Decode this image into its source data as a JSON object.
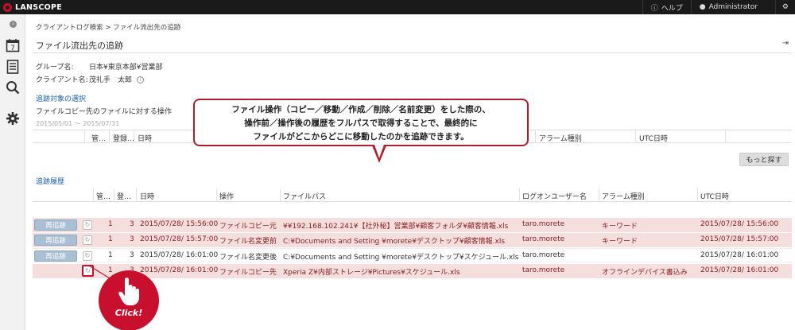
{
  "topbar": {
    "brand": "LANSCOPE",
    "help": "ヘルプ",
    "user": "Administrator",
    "help_icon": "question-circle-icon",
    "user_icon": "user-icon",
    "settings_icon": "gear-icon"
  },
  "sidebar": {
    "items": [
      {
        "name": "calendar",
        "icon": "calendar-icon",
        "glyph": "7"
      },
      {
        "name": "log",
        "icon": "document-icon"
      },
      {
        "name": "search",
        "icon": "search-icon"
      },
      {
        "name": "settings",
        "icon": "gear-icon"
      }
    ]
  },
  "breadcrumb": "クライアントログ検索 > ファイル流出先の追跡",
  "page_title": "ファイル流出先の追跡",
  "info": {
    "group_label": "グループ名:",
    "group_value": "日本¥東京本部¥営業部",
    "client_label": "クライアント名:",
    "client_value": "茂礼手　太郎"
  },
  "selection": {
    "title": "追跡対象の選択",
    "subtitle": "ファイルコピー先のファイルに対する操作",
    "date_range": "2015/05/01 ～ 2015/07/31",
    "columns": [
      "管…",
      "登録…",
      "日時",
      "アラーム種別",
      "UTC日時"
    ]
  },
  "more_button": "もっと探す",
  "history": {
    "title": "追跡履歴",
    "columns": [
      "管…",
      "登…",
      "日時",
      "操作",
      "ファイルパス",
      "ログオンユーザー名",
      "アラーム種別",
      "UTC日時"
    ],
    "rows": [
      {
        "button": "再追跡",
        "kan": "1",
        "to": "3",
        "datetime": "2015/07/28/ 15:56:00",
        "op": "ファイルコピー元",
        "path": "¥¥192.168.102.241¥【社外秘】営業部¥顧客フォルダ¥顧客情報.xls",
        "user": "taro.morete",
        "alarm": "キーワード",
        "utc": "2015/07/28/ 15:56:00",
        "style": "pink"
      },
      {
        "button": "再追跡",
        "kan": "1",
        "to": "3",
        "datetime": "2015/07/28/ 15:57:00",
        "op": "ファイル名変更前",
        "path": "C:¥Documents and Setting ¥morete¥デスクトップ¥顧客情報.xls",
        "user": "taro.morete",
        "alarm": "キーワード",
        "utc": "2015/07/28/ 15:57:00",
        "style": "pink"
      },
      {
        "button": "再追跡",
        "kan": "1",
        "to": "3",
        "datetime": "2015/07/28/ 16:01:00",
        "op": "ファイル名変更後",
        "path": "C:¥Documents and Setting ¥morete¥デスクトップ¥スケジュール.xls",
        "user": "taro.morete",
        "alarm": "",
        "utc": "2015/07/28/ 16:01:00",
        "style": "white"
      },
      {
        "button": "",
        "kan": "1",
        "to": "3",
        "datetime": "2015/07/28/ 16:01:00",
        "op": "ファイルコピー先",
        "path": "Xperia Z¥内部ストレージ¥Pictures¥スケジュール.xls",
        "user": "taro.morete",
        "alarm": "オフラインデバイス書込み",
        "utc": "2015/07/28/ 16:01:00",
        "style": "pink"
      }
    ]
  },
  "callout": {
    "line1": "ファイル操作（コピー／移動／作成／削除／名前変更）をした際の、",
    "line2": "操作前／操作後の履歴をフルパスで取得することで、最終的に",
    "line3": "ファイルがどこからどこに移動したのかを追跡できます。"
  },
  "click_badge": "Click!",
  "colors": {
    "brand_red": "#c8102e",
    "row_pink": "#f5dede",
    "row_text": "#8a1c1c",
    "link": "#1a5ea6"
  }
}
